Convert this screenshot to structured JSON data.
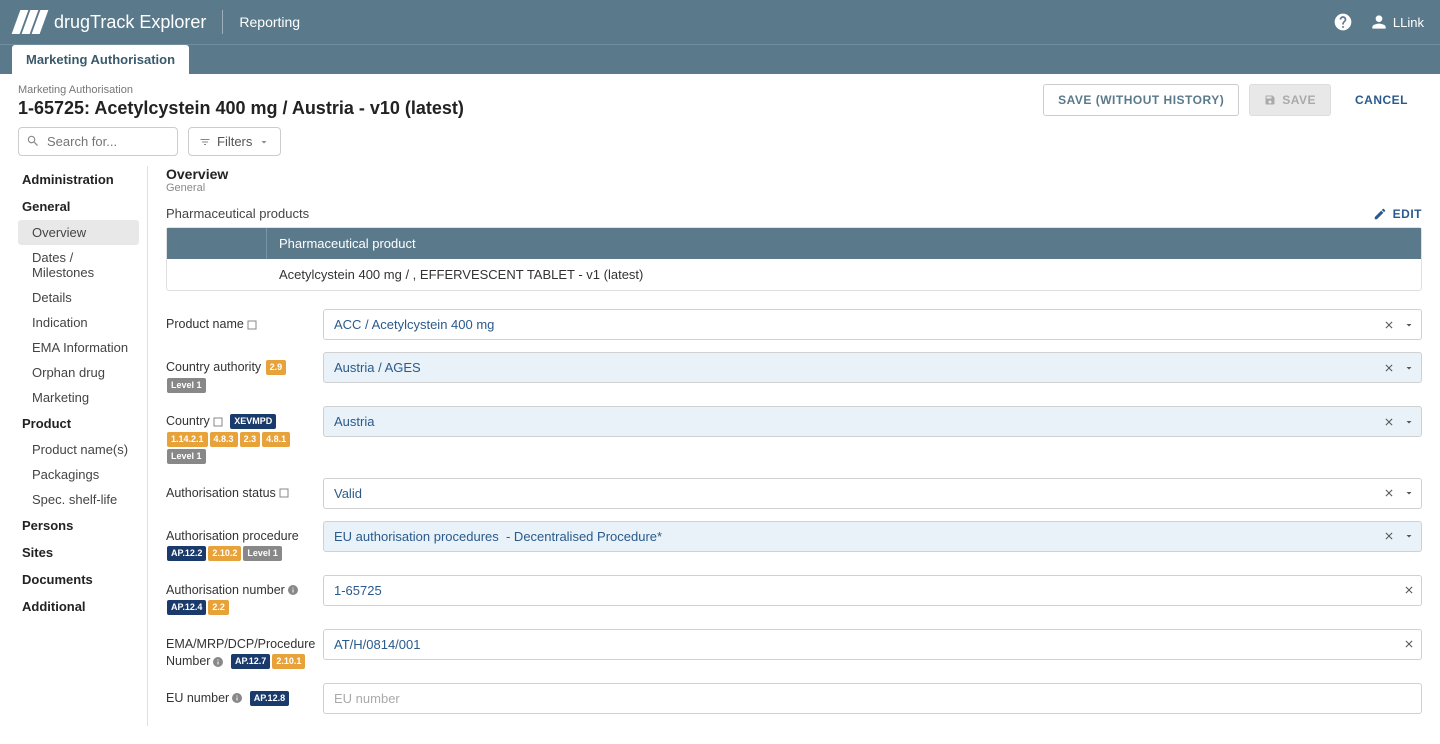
{
  "header": {
    "app_name": "drugTrack Explorer",
    "nav_link": "Reporting",
    "user_name": "LLink"
  },
  "tab": {
    "label": "Marketing Authorisation"
  },
  "page": {
    "breadcrumb": "Marketing Authorisation",
    "title": "1-65725: Acetylcystein 400 mg / Austria - v10 (latest)",
    "actions": {
      "save_nohist": "SAVE (WITHOUT HISTORY)",
      "save": "SAVE",
      "cancel": "CANCEL"
    }
  },
  "toolbar": {
    "search_placeholder": "Search for...",
    "filters_label": "Filters"
  },
  "sidebar": {
    "groups": [
      {
        "title": "Administration",
        "items": []
      },
      {
        "title": "General",
        "items": [
          "Overview",
          "Dates / Milestones",
          "Details",
          "Indication",
          "EMA Information",
          "Orphan drug",
          "Marketing"
        ],
        "active": "Overview"
      },
      {
        "title": "Product",
        "items": [
          "Product name(s)",
          "Packagings",
          "Spec. shelf-life"
        ]
      },
      {
        "title": "Persons",
        "items": []
      },
      {
        "title": "Sites",
        "items": []
      },
      {
        "title": "Documents",
        "items": []
      },
      {
        "title": "Additional",
        "items": []
      }
    ]
  },
  "overview": {
    "title": "Overview",
    "subtitle": "General",
    "table": {
      "heading": "Pharmaceutical products",
      "edit_label": "EDIT",
      "col_header": "Pharmaceutical product",
      "row": "Acetylcystein 400 mg / , EFFERVESCENT TABLET - v1 (latest)"
    },
    "fields": [
      {
        "label": "Product name",
        "value": "ACC / Acetylcystein 400 mg",
        "highlight": false,
        "dropdown": true,
        "clearable": true,
        "info": false,
        "box": true,
        "badges": []
      },
      {
        "label": "Country authority",
        "value": "Austria / AGES",
        "highlight": true,
        "dropdown": true,
        "clearable": true,
        "info": false,
        "box": false,
        "badges": [
          {
            "t": "2.9",
            "c": "b-orange"
          },
          {
            "t": "Level 1",
            "c": "b-grey"
          }
        ]
      },
      {
        "label": "Country",
        "value": "Austria",
        "highlight": true,
        "dropdown": true,
        "clearable": true,
        "info": false,
        "box": true,
        "badges": [
          {
            "t": "XEVMPD",
            "c": "b-darkblue"
          },
          {
            "t": "1.14.2.1",
            "c": "b-orange"
          },
          {
            "t": "4.8.3",
            "c": "b-orange"
          },
          {
            "t": "2.3",
            "c": "b-orange"
          },
          {
            "t": "4.8.1",
            "c": "b-orange"
          },
          {
            "t": "Level 1",
            "c": "b-grey"
          }
        ]
      },
      {
        "label": "Authorisation status",
        "value": "Valid",
        "highlight": false,
        "dropdown": true,
        "clearable": true,
        "info": false,
        "box": true,
        "badges": []
      },
      {
        "label": "Authorisation procedure",
        "value": "EU authorisation procedures  - Decentralised Procedure*",
        "highlight": true,
        "dropdown": true,
        "clearable": true,
        "info": false,
        "box": false,
        "badges": [
          {
            "t": "AP.12.2",
            "c": "b-darkblue"
          },
          {
            "t": "2.10.2",
            "c": "b-orange"
          },
          {
            "t": "Level 1",
            "c": "b-grey"
          }
        ]
      },
      {
        "label": "Authorisation number",
        "value": "1-65725",
        "highlight": false,
        "dropdown": false,
        "clearable": true,
        "info": true,
        "box": false,
        "badges": [
          {
            "t": "AP.12.4",
            "c": "b-darkblue"
          },
          {
            "t": "2.2",
            "c": "b-orange"
          }
        ]
      },
      {
        "label": "EMA/MRP/DCP/Procedure Number",
        "value": "AT/H/0814/001",
        "highlight": false,
        "dropdown": false,
        "clearable": true,
        "info": true,
        "box": false,
        "badges": [
          {
            "t": "AP.12.7",
            "c": "b-darkblue"
          },
          {
            "t": "2.10.1",
            "c": "b-orange"
          }
        ]
      },
      {
        "label": "EU number",
        "value": "",
        "placeholder": "EU number",
        "highlight": false,
        "dropdown": false,
        "clearable": false,
        "info": true,
        "box": false,
        "badges": [
          {
            "t": "AP.12.8",
            "c": "b-darkblue"
          }
        ]
      }
    ]
  }
}
